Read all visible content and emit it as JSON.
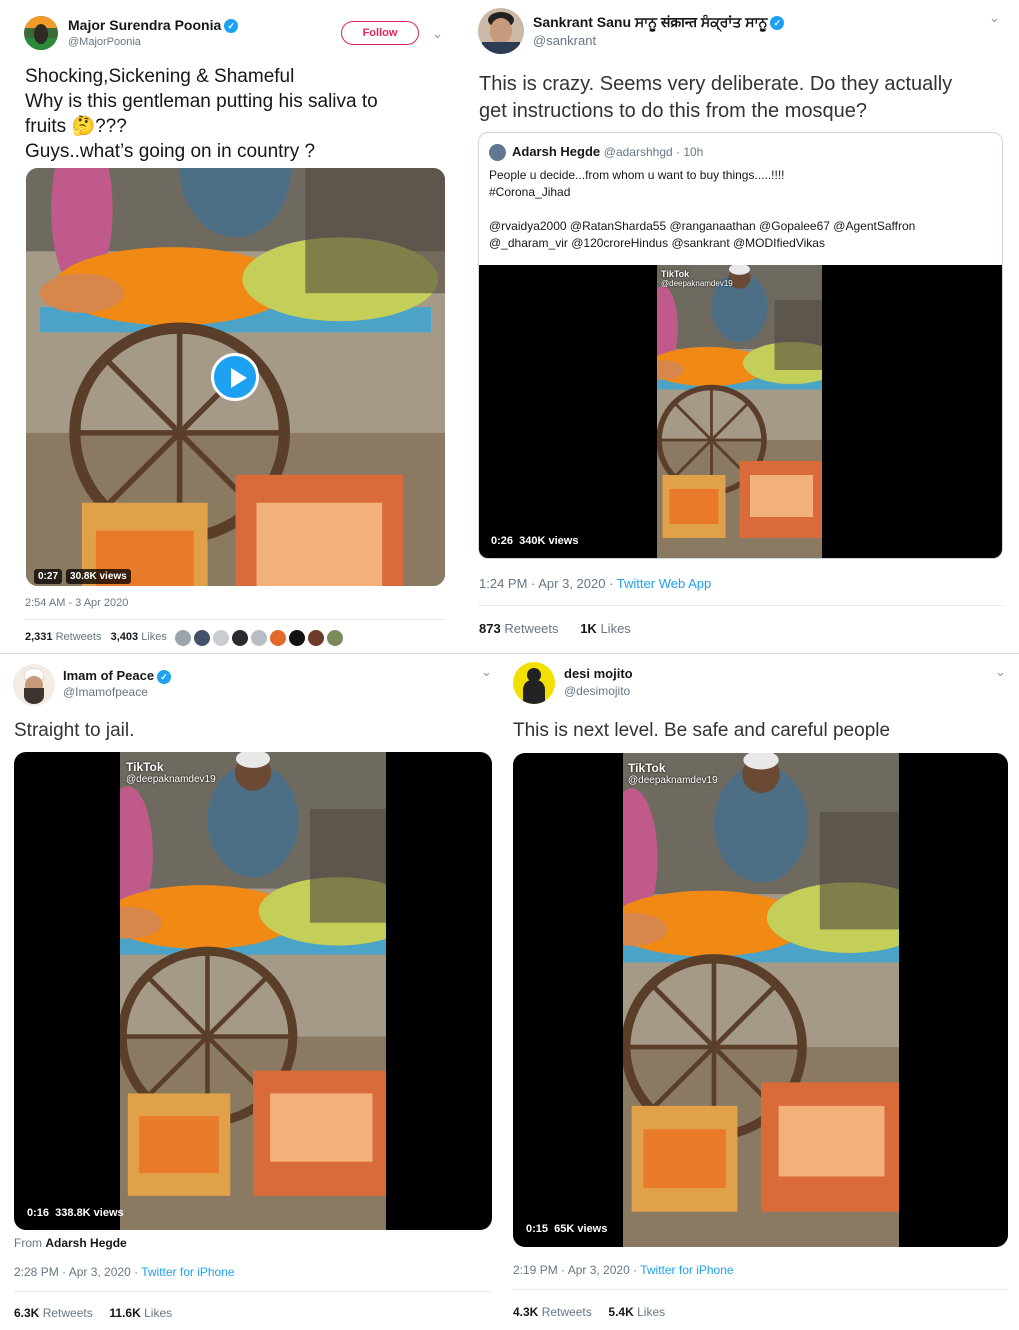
{
  "tweet1": {
    "name": "Major Surendra Poonia",
    "handle": "@MajorPoonia",
    "follow_label": "Follow",
    "lines": [
      "Shocking,Sickening & Shameful",
      "Why is this gentleman putting his saliva to",
      "fruits 🤔???",
      "Guys..what’s going on in country ?"
    ],
    "video_time": "0:27",
    "video_views": "30.8K views",
    "timestamp": "2:54 AM - 3 Apr 2020",
    "retweets_count": "2,331",
    "retweets_label": "Retweets",
    "likes_count": "3,403",
    "likes_label": "Likes"
  },
  "tweet2": {
    "name": "Sankrant Sanu ਸਾਨੂ संक्रान्त ਸੰਕ੍ਰਾਂਤ ਸਾਨੂ",
    "handle": "@sankrant",
    "lines": [
      "This is crazy. Seems very deliberate. Do they actually",
      "get instructions to do this from the mosque?"
    ],
    "quote": {
      "name": "Adarsh Hegde",
      "handle": "@adarshhgd · 10h",
      "lines": [
        "People u decide...from whom u want to buy things.....!!!!",
        "#Corona_Jihad",
        "",
        "@rvaidya2000 @RatanSharda55 @ranganaathan @Gopalee67 @AgentSaffron",
        "@_dharam_vir @120croreHindus @sankrant @MODIfiedVikas"
      ],
      "tiktok": "TikTok",
      "tiktok_handle": "@deepaknamdev19",
      "video_time": "0:26",
      "video_views": "340K views"
    },
    "timestamp": "1:24 PM · Apr 3, 2020 · ",
    "source": "Twitter Web App",
    "retweets_count": "873",
    "retweets_label": "Retweets",
    "likes_count": "1K",
    "likes_label": "Likes"
  },
  "tweet3": {
    "name": "Imam of Peace",
    "handle": "@Imamofpeace",
    "text": "Straight to jail.",
    "tiktok": "TikTok",
    "tiktok_handle": "@deepaknamdev19",
    "video_time": "0:16",
    "video_views": "338.8K views",
    "from_label": "From",
    "from_name": "Adarsh Hegde",
    "timestamp": "2:28 PM · Apr 3, 2020 · ",
    "source": "Twitter for iPhone",
    "retweets_count": "6.3K",
    "retweets_label": "Retweets",
    "likes_count": "11.6K",
    "likes_label": "Likes"
  },
  "tweet4": {
    "name": "desi mojito",
    "handle": "@desimojito",
    "text": "This is next level. Be safe and careful people",
    "tiktok": "TikTok",
    "tiktok_handle": "@deepaknamdev19",
    "video_time": "0:15",
    "video_views": "65K views",
    "timestamp": "2:19 PM · Apr 3, 2020 · ",
    "source": "Twitter for iPhone",
    "retweets_count": "4.3K",
    "retweets_label": "Retweets",
    "likes_count": "5.4K",
    "likes_label": "Likes"
  },
  "icons": {
    "verified": "verified-badge-icon",
    "caret": "chevron-down-icon",
    "play": "play-icon"
  },
  "colors": {
    "link": "#1da1f2",
    "follow": "#e0245e",
    "muted": "#657786"
  }
}
